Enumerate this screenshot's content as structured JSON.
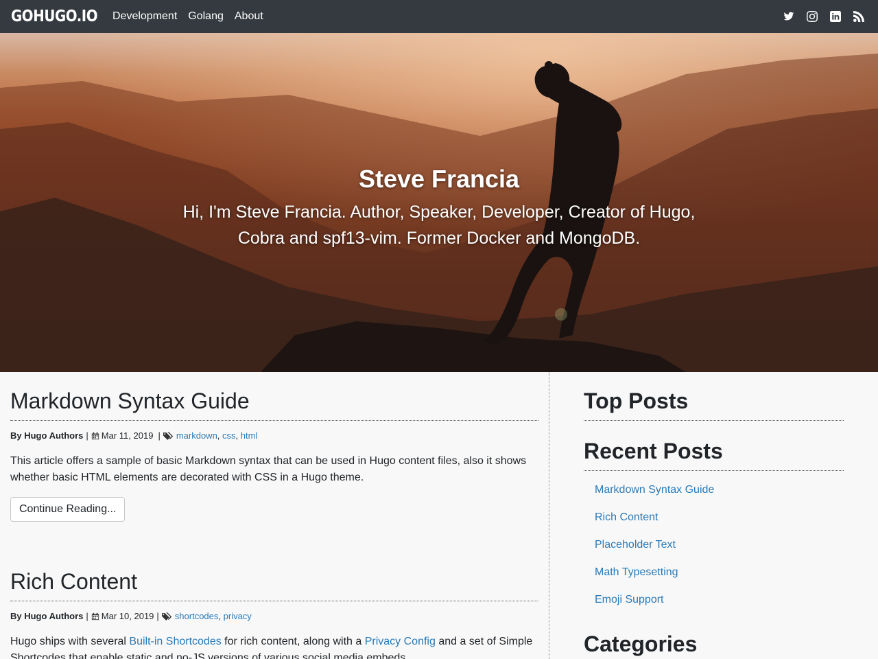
{
  "nav": {
    "brand": "GOHUGO.IO",
    "links": [
      "Development",
      "Golang",
      "About"
    ],
    "social_icons": [
      "twitter-icon",
      "instagram-icon",
      "linkedin-icon",
      "rss-icon"
    ]
  },
  "hero": {
    "title": "Steve Francia",
    "subtitle": "Hi, I'm Steve Francia. Author, Speaker, Developer, Creator of Hugo, Cobra and spf13-vim. Former Docker and MongoDB."
  },
  "posts": [
    {
      "title": "Markdown Syntax Guide",
      "author": "By Hugo Authors",
      "date": "Mar 11, 2019",
      "tags": [
        "markdown",
        "css",
        "html"
      ],
      "summary": "This article offers a sample of basic Markdown syntax that can be used in Hugo content files, also it shows whether basic HTML elements are decorated with CSS in a Hugo theme.",
      "button": "Continue Reading..."
    },
    {
      "title": "Rich Content",
      "author": "By Hugo Authors",
      "date": "Mar 10, 2019",
      "tags": [
        "shortcodes",
        "privacy"
      ],
      "summary_parts": {
        "p1": "Hugo ships with several ",
        "link1": "Built-in Shortcodes",
        "p2": " for rich content, along with a ",
        "link2": "Privacy Config",
        "p3": " and a set of Simple Shortcodes that enable static and no-JS versions of various social media embeds."
      }
    }
  ],
  "sidebar": {
    "top_posts_title": "Top Posts",
    "recent_posts_title": "Recent Posts",
    "recent_posts": [
      "Markdown Syntax Guide",
      "Rich Content",
      "Placeholder Text",
      "Math Typesetting",
      "Emoji Support"
    ],
    "categories_title": "Categories"
  },
  "colors": {
    "navbar": "#343a40",
    "link": "#2a7ab8",
    "background": "#f8f8f8"
  }
}
